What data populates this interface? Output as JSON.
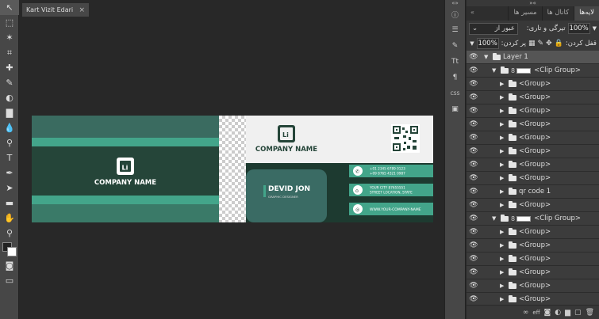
{
  "document": {
    "tab_title": "Kart Vizit Edari",
    "tab_close": "×"
  },
  "tools": [
    {
      "name": "move-tool-icon",
      "glyph": "↖"
    },
    {
      "name": "marquee-tool-icon",
      "glyph": "⬚"
    },
    {
      "name": "magic-wand-icon",
      "glyph": "✶"
    },
    {
      "name": "crop-tool-icon",
      "glyph": "⌗"
    },
    {
      "name": "heal-tool-icon",
      "glyph": "✚"
    },
    {
      "name": "brush-tool-icon",
      "glyph": "✎"
    },
    {
      "name": "eraser-tool-icon",
      "glyph": "◐"
    },
    {
      "name": "gradient-tool-icon",
      "glyph": "▇"
    },
    {
      "name": "blur-tool-icon",
      "glyph": "💧"
    },
    {
      "name": "dodge-tool-icon",
      "glyph": "⚲"
    },
    {
      "name": "type-tool-icon",
      "glyph": "T"
    },
    {
      "name": "pen-tool-icon",
      "glyph": "✒"
    },
    {
      "name": "path-select-icon",
      "glyph": "➤"
    },
    {
      "name": "shape-tool-icon",
      "glyph": "▬"
    },
    {
      "name": "hand-tool-icon",
      "glyph": "✋"
    },
    {
      "name": "zoom-tool-icon",
      "glyph": "⚲"
    }
  ],
  "bottom_tools": [
    {
      "name": "quick-mask-icon",
      "glyph": "◙"
    },
    {
      "name": "screen-mode-icon",
      "glyph": "▭"
    }
  ],
  "mini_strip": [
    {
      "name": "info-icon",
      "glyph": "ⓘ"
    },
    {
      "name": "adjustments-icon",
      "glyph": "☰"
    },
    {
      "name": "brush-settings-icon",
      "glyph": "✎"
    },
    {
      "name": "character-icon",
      "glyph": "Tt"
    },
    {
      "name": "paragraph-icon",
      "glyph": "¶"
    },
    {
      "name": "css-icon",
      "glyph": "CSS"
    },
    {
      "name": "image-icon",
      "glyph": "▣"
    }
  ],
  "panel": {
    "tabs": [
      "لایه‌ها",
      "کانال ها",
      "مسیر ها"
    ],
    "close": "»",
    "blend_mode": "عبور از",
    "opacity_label": "تیرگی و تاری:",
    "opacity_value": "100%",
    "lock_label": "قفل کردن:",
    "fill_label": "پر کردن:",
    "fill_value": "100%"
  },
  "card": {
    "company_name": "COMPANY NAME",
    "logo_text": "Li",
    "person_name": "DEVID JON",
    "person_title": "GRAPHIC DESIGNER",
    "phone_1": "+01 2345 6789 0123",
    "phone_2": "+09 8765 4321 0987",
    "address_1": "YOUR CITY 87655551",
    "address_2": "STREET LOCATION, STATE",
    "website": "WWW.YOUR-COMPANY-NAME",
    "colors": {
      "dark": "#254539",
      "mid": "#3a7a68",
      "accent": "#43a58a",
      "light": "#f0f0f0"
    }
  },
  "layers": [
    {
      "indent": 0,
      "arrow": "▼",
      "label": "Layer 1",
      "top": true,
      "chain": false,
      "thumb": false
    },
    {
      "indent": 1,
      "arrow": "▼",
      "label": "<Clip Group>",
      "chain": true,
      "thumb": true
    },
    {
      "indent": 2,
      "arrow": "▶",
      "label": "<Group>"
    },
    {
      "indent": 2,
      "arrow": "▶",
      "label": "<Group>"
    },
    {
      "indent": 2,
      "arrow": "▶",
      "label": "<Group>"
    },
    {
      "indent": 2,
      "arrow": "▶",
      "label": "<Group>"
    },
    {
      "indent": 2,
      "arrow": "▶",
      "label": "<Group>"
    },
    {
      "indent": 2,
      "arrow": "▶",
      "label": "<Group>"
    },
    {
      "indent": 2,
      "arrow": "▶",
      "label": "<Group>"
    },
    {
      "indent": 2,
      "arrow": "▶",
      "label": "<Group>"
    },
    {
      "indent": 2,
      "arrow": "▶",
      "label": "qr code 1"
    },
    {
      "indent": 2,
      "arrow": "▶",
      "label": "<Group>"
    },
    {
      "indent": 1,
      "arrow": "▼",
      "label": "<Clip Group>",
      "chain": true,
      "thumb": true
    },
    {
      "indent": 2,
      "arrow": "▶",
      "label": "<Group>"
    },
    {
      "indent": 2,
      "arrow": "▶",
      "label": "<Group>"
    },
    {
      "indent": 2,
      "arrow": "▶",
      "label": "<Group>"
    },
    {
      "indent": 2,
      "arrow": "▶",
      "label": "<Group>"
    },
    {
      "indent": 2,
      "arrow": "▶",
      "label": "<Group>"
    },
    {
      "indent": 2,
      "arrow": "▶",
      "label": "<Group>"
    },
    {
      "indent": 2,
      "arrow": "▶",
      "label": "<Group>"
    },
    {
      "indent": 2,
      "arrow": "▶",
      "label": "<Group>"
    }
  ],
  "footer_icons": [
    "link-layers-icon",
    "effects-icon",
    "mask-icon",
    "adjustment-layer-icon",
    "new-group-icon",
    "new-layer-icon",
    "delete-layer-icon"
  ],
  "footer_glyphs": [
    "∞",
    "eff",
    "◙",
    "◐",
    "▆",
    "▢",
    "🗑"
  ]
}
